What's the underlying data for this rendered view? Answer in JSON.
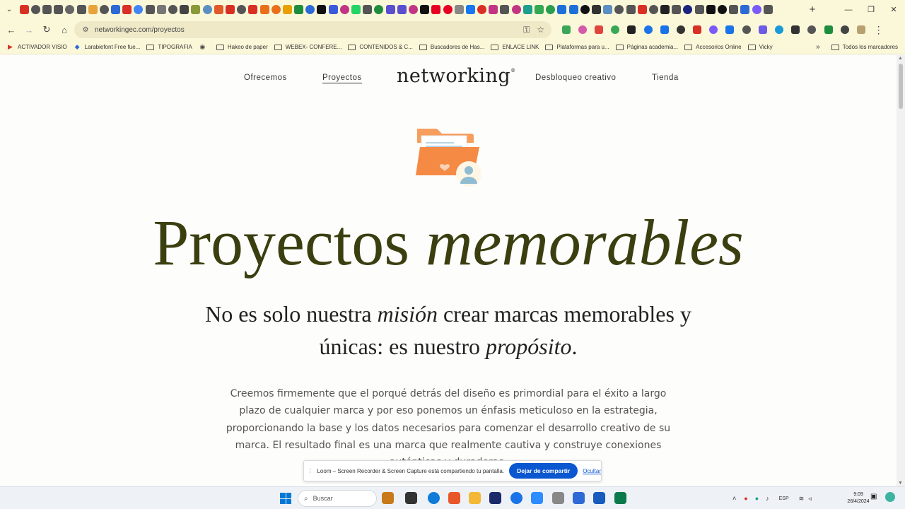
{
  "browser": {
    "tab_menu_icon": "chevron-down",
    "new_tab_icon": "+",
    "window_controls": {
      "minimize": "—",
      "maximize": "❐",
      "close": "✕"
    },
    "tab_favicon_colors": [
      "#d93025",
      "#555555",
      "#555555",
      "#555555",
      "#666666",
      "#555555",
      "#e8a33a",
      "#555555",
      "#2d6ad6",
      "#d93025",
      "#4285f4",
      "#555555",
      "#777777",
      "#555555",
      "#444444",
      "#8a9a3a",
      "#5a8fc2",
      "#e05a2a",
      "#d93025",
      "#555555",
      "#d93025",
      "#e8701a",
      "#e8701a",
      "#e8a000",
      "#1e8e3e",
      "#2d6ad6",
      "#111111",
      "#3b5bdb",
      "#c13584",
      "#25d366",
      "#555555",
      "#1e8e3e",
      "#5a4fcf",
      "#5a4fcf",
      "#c13584",
      "#111111",
      "#e60023",
      "#e60023",
      "#888888",
      "#1877f2",
      "#d93025",
      "#c13584",
      "#555555",
      "#c13584",
      "#1e9e8e",
      "#34a853",
      "#2a9d4e",
      "#1e6fd9",
      "#1e6fd9",
      "#111111",
      "#333333",
      "#5a8fc2",
      "#555555",
      "#555555",
      "#d93025",
      "#555555",
      "#222222",
      "#555555",
      "#1a237e",
      "#555555",
      "#111111",
      "#111111",
      "#555555",
      "#2d6ad6",
      "#7a5af8",
      "#555555"
    ],
    "address": {
      "url": "networkingec.com/proyectos",
      "site_info_icon": "tune-icon",
      "password_icon": "key-icon",
      "bookmark_icon": "star-icon"
    },
    "extension_colors": [
      "#3aa757",
      "#d659a8",
      "#e0463c",
      "#3aa757",
      "#222222",
      "#1a73e8",
      "#1a73e8",
      "#333333",
      "#d93025",
      "#7a5af8",
      "#1a73e8",
      "#555555",
      "#6c5ce7",
      "#1a9bd7",
      "#333333",
      "#555555",
      "#1e8e3e",
      "#444444",
      "#b8a070"
    ],
    "bookmarks": [
      {
        "icon": "youtube-icon",
        "label": "ACTIVADOR VISIO",
        "color": "#d93025"
      },
      {
        "icon": "site-icon",
        "label": "Larabiefont Free fue...",
        "color": "#2d6ad6"
      },
      {
        "icon": "folder-icon",
        "label": "TIPOGRAFIA"
      },
      {
        "icon": "globe-icon",
        "label": "",
        "color": "#444444"
      },
      {
        "icon": "folder-icon",
        "label": "Hakeo de paper"
      },
      {
        "icon": "folder-icon",
        "label": "WEBEX- CONFERE..."
      },
      {
        "icon": "folder-icon",
        "label": "CONTENIDOS & C..."
      },
      {
        "icon": "folder-icon",
        "label": "Buscadores de Has..."
      },
      {
        "icon": "folder-icon",
        "label": "ENLACE LINK"
      },
      {
        "icon": "folder-icon",
        "label": "Plataformas para u..."
      },
      {
        "icon": "folder-icon",
        "label": "Páginas academia..."
      },
      {
        "icon": "folder-icon",
        "label": "Accesorios Online"
      },
      {
        "icon": "folder-icon",
        "label": "Vicky"
      }
    ],
    "bookmarks_overflow": "»",
    "all_bookmarks": "Todos los marcadores"
  },
  "site": {
    "nav": {
      "offer": "Ofrecemos",
      "projects": "Proyectos",
      "logo": "networking",
      "logo_mark": "®",
      "creative": "Desbloqueo creativo",
      "shop": "Tienda"
    },
    "hero": {
      "title_plain": "Proyectos ",
      "title_italic": "memorables",
      "sub_1": "No es solo nuestra ",
      "sub_2": "misión",
      "sub_3": " crear marcas memorables y únicas: es nuestro ",
      "sub_4": "propósito",
      "sub_5": ".",
      "body": "Creemos firmemente que el porqué detrás del diseño es primordial para el éxito a largo plazo de cualquier marca y por eso ponemos un énfasis meticuloso en la estrategia, proporcionando la base y los datos necesarios para comenzar el desarrollo creativo de su marca. El resultado final es una marca que realmente cautiva y construye conexiones auténticas y duraderas."
    },
    "colors": {
      "headline": "#3b3f10",
      "folder": "#f58a45",
      "avatar": "#7fb2c9"
    }
  },
  "loom": {
    "message": "Loom – Screen Recorder & Screen Capture está compartiendo tu pantalla.",
    "stop": "Dejar de compartir",
    "hide": "Ocultar"
  },
  "taskbar": {
    "search_placeholder": "Buscar",
    "language": "ESP",
    "time": "9:09",
    "date": "26/4/2024",
    "app_colors": [
      "#c87a1a",
      "#333333",
      "#0f7bd8",
      "#e8562a",
      "#f2b836",
      "#1b2a6b",
      "#1a73e8",
      "#2d8cff",
      "#888888",
      "#2d6ad6",
      "#185abd",
      "#0b7a4b"
    ]
  }
}
